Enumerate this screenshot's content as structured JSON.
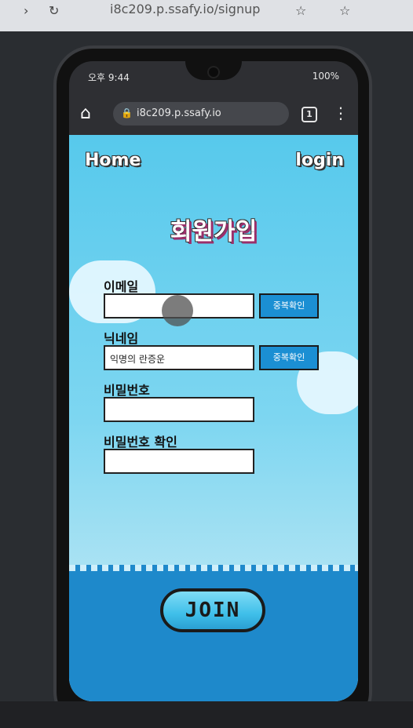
{
  "desktop": {
    "url": "i8c209.p.ssafy.io/signup"
  },
  "phone": {
    "status": {
      "time": "오후 9:44",
      "battery": "100%"
    },
    "browser": {
      "url": "i8c209.p.ssafy.io",
      "tab_count": "1"
    }
  },
  "page": {
    "nav": {
      "home": "Home",
      "login": "login"
    },
    "title": "회원가입",
    "form": {
      "email": {
        "label": "이메일",
        "value": "",
        "check_button": "중복확인"
      },
      "nickname": {
        "label": "닉네임",
        "value": "익명의 란증운",
        "check_button": "중복확인"
      },
      "password": {
        "label": "비밀번호",
        "value": ""
      },
      "password_confirm": {
        "label": "비밀번호 확인",
        "value": ""
      }
    },
    "join_button": "JOIN"
  },
  "colors": {
    "sky": "#57c9ec",
    "ground": "#1e89cb",
    "button": "#1b8fd3",
    "title_shadow": "#9b2f6a"
  }
}
